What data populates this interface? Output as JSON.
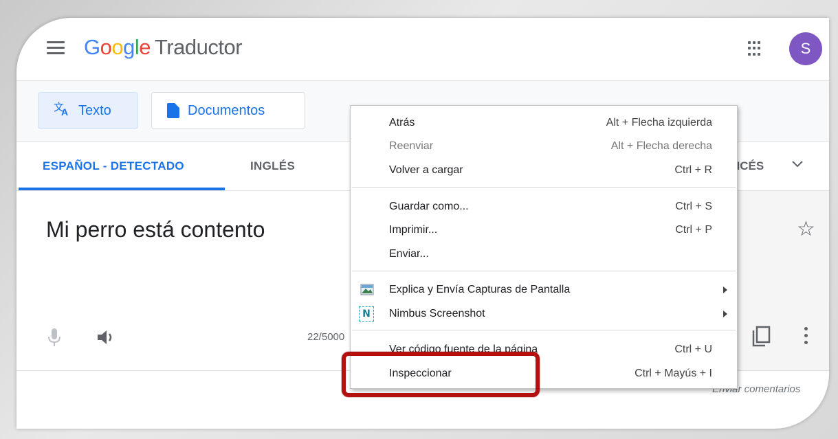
{
  "app": {
    "logo_letters": [
      "G",
      "o",
      "o",
      "g",
      "l",
      "e"
    ],
    "product_name": "Traductor",
    "avatar_letter": "S"
  },
  "modes": [
    {
      "label": "Texto",
      "icon": "translate-icon",
      "active": true
    },
    {
      "label": "Documentos",
      "icon": "document-icon",
      "active": false
    }
  ],
  "languages": {
    "source_tabs": [
      {
        "label": "ESPAÑOL - DETECTADO",
        "active": true
      },
      {
        "label": "INGLÉS",
        "active": false
      }
    ],
    "target_partial": "NCÉS"
  },
  "input": {
    "text": "Mi perro está contento",
    "char_count": "22/5000"
  },
  "footer": {
    "feedback": "Enviar comentarios"
  },
  "context_menu": {
    "items": [
      {
        "label": "Atrás",
        "shortcut": "Alt + Flecha izquierda",
        "disabled": false
      },
      {
        "label": "Reenviar",
        "shortcut": "Alt + Flecha derecha",
        "disabled": true
      },
      {
        "label": "Volver a cargar",
        "shortcut": "Ctrl + R",
        "disabled": false
      },
      {
        "label": "Guardar como...",
        "shortcut": "Ctrl + S",
        "disabled": false
      },
      {
        "label": "Imprimir...",
        "shortcut": "Ctrl + P",
        "disabled": false
      },
      {
        "label": "Enviar...",
        "shortcut": "",
        "disabled": false
      },
      {
        "label": "Explica y Envía Capturas de Pantalla",
        "shortcut": "",
        "submenu": true,
        "icon": "screenshot-extension-icon"
      },
      {
        "label": "Nimbus Screenshot",
        "shortcut": "",
        "submenu": true,
        "icon": "nimbus-icon",
        "icon_text": "N"
      },
      {
        "label": "Ver código fuente de la página",
        "shortcut": "Ctrl + U",
        "disabled": false
      },
      {
        "label": "Inspeccionar",
        "shortcut": "Ctrl + Mayús + I",
        "disabled": false,
        "highlighted": true
      }
    ]
  },
  "colors": {
    "accent_blue": "#1a73e8",
    "avatar_purple": "#7e57c2",
    "highlight_red": "#b51010"
  }
}
